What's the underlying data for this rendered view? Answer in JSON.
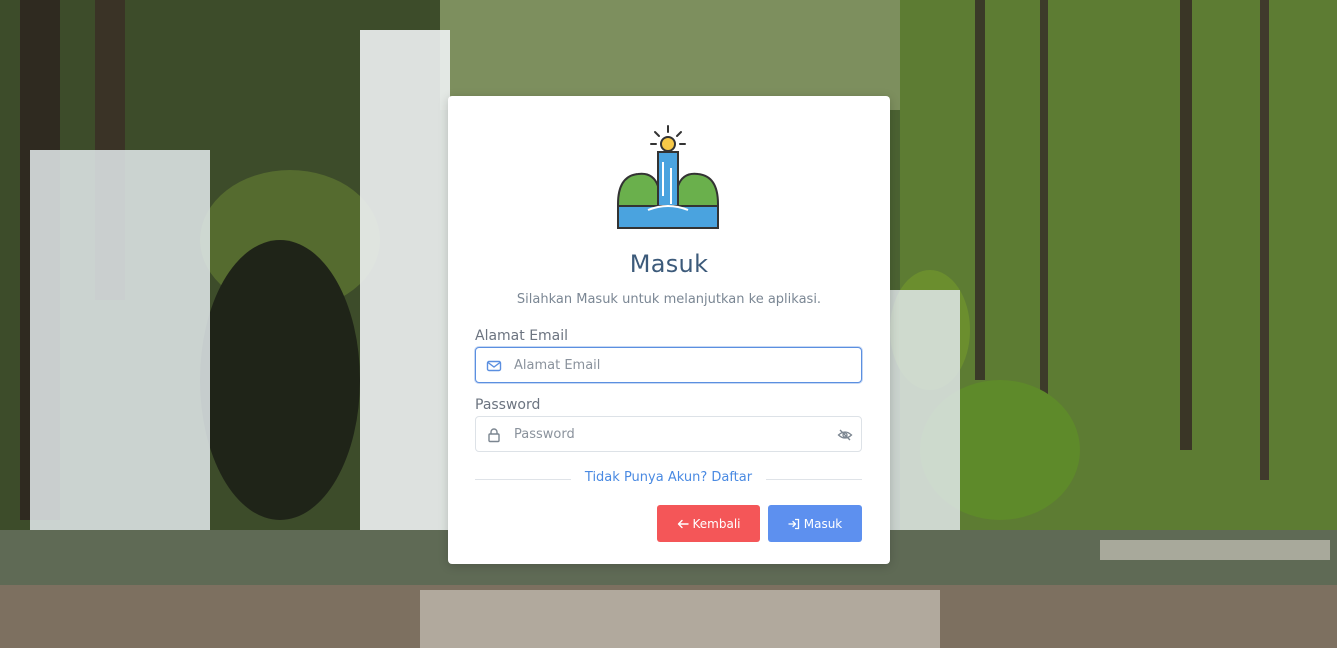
{
  "login": {
    "title": "Masuk",
    "subtitle": "Silahkan Masuk untuk melanjutkan ke aplikasi.",
    "email": {
      "label": "Alamat Email",
      "placeholder": "Alamat Email",
      "value": ""
    },
    "password": {
      "label": "Password",
      "placeholder": "Password",
      "value": ""
    },
    "register_link": "Tidak Punya Akun? Daftar",
    "back_button": "Kembali",
    "login_button": "Masuk"
  },
  "colors": {
    "title": "#3c5a7a",
    "link": "#4a8ae2",
    "back_button": "#f45658",
    "login_button": "#5d90ef",
    "focus_border": "#5b8fe0"
  },
  "icons": {
    "logo": "waterfall-logo",
    "email": "envelope-icon",
    "password": "lock-icon",
    "toggle": "eye-slash-icon",
    "back": "arrow-left-icon",
    "login": "sign-in-icon"
  }
}
